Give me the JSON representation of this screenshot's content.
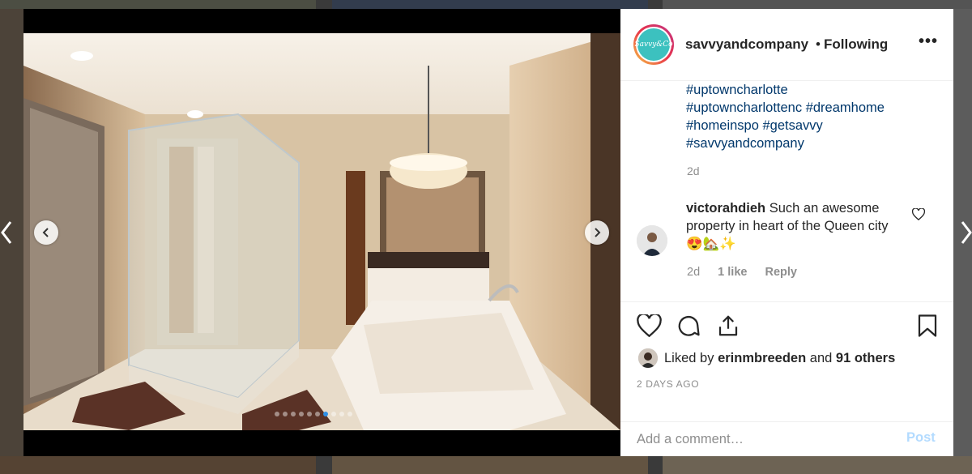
{
  "post": {
    "username": "savvyandcompany",
    "separator": "•",
    "follow_status": "Following",
    "more_label": "•••",
    "avatar_text": "Savvy&Co",
    "hashtags": [
      "#uptowncharlotte",
      "#uptowncharlottenc",
      "#dreamhome",
      "#homeinspo",
      "#getsavvy",
      "#savvyandcompany"
    ],
    "caption_time": "2d",
    "comment": {
      "username": "victorahdieh",
      "text": "Such an awesome property in heart of the Queen city 😍🏡✨",
      "time": "2d",
      "likes": "1 like",
      "reply": "Reply"
    },
    "liked_prefix": "Liked by ",
    "liked_user": "erinmbreeden",
    "liked_mid": " and ",
    "liked_others": "91 others",
    "date": "2 DAYS AGO",
    "comment_placeholder": "Add a comment…",
    "post_label": "Post",
    "carousel": {
      "total": 10,
      "active": 7
    }
  },
  "colors": {
    "link": "#00376b",
    "secondary": "#8e8e8e",
    "dot_active": "#2f8fe6",
    "post_disabled": "#b3dbff"
  }
}
